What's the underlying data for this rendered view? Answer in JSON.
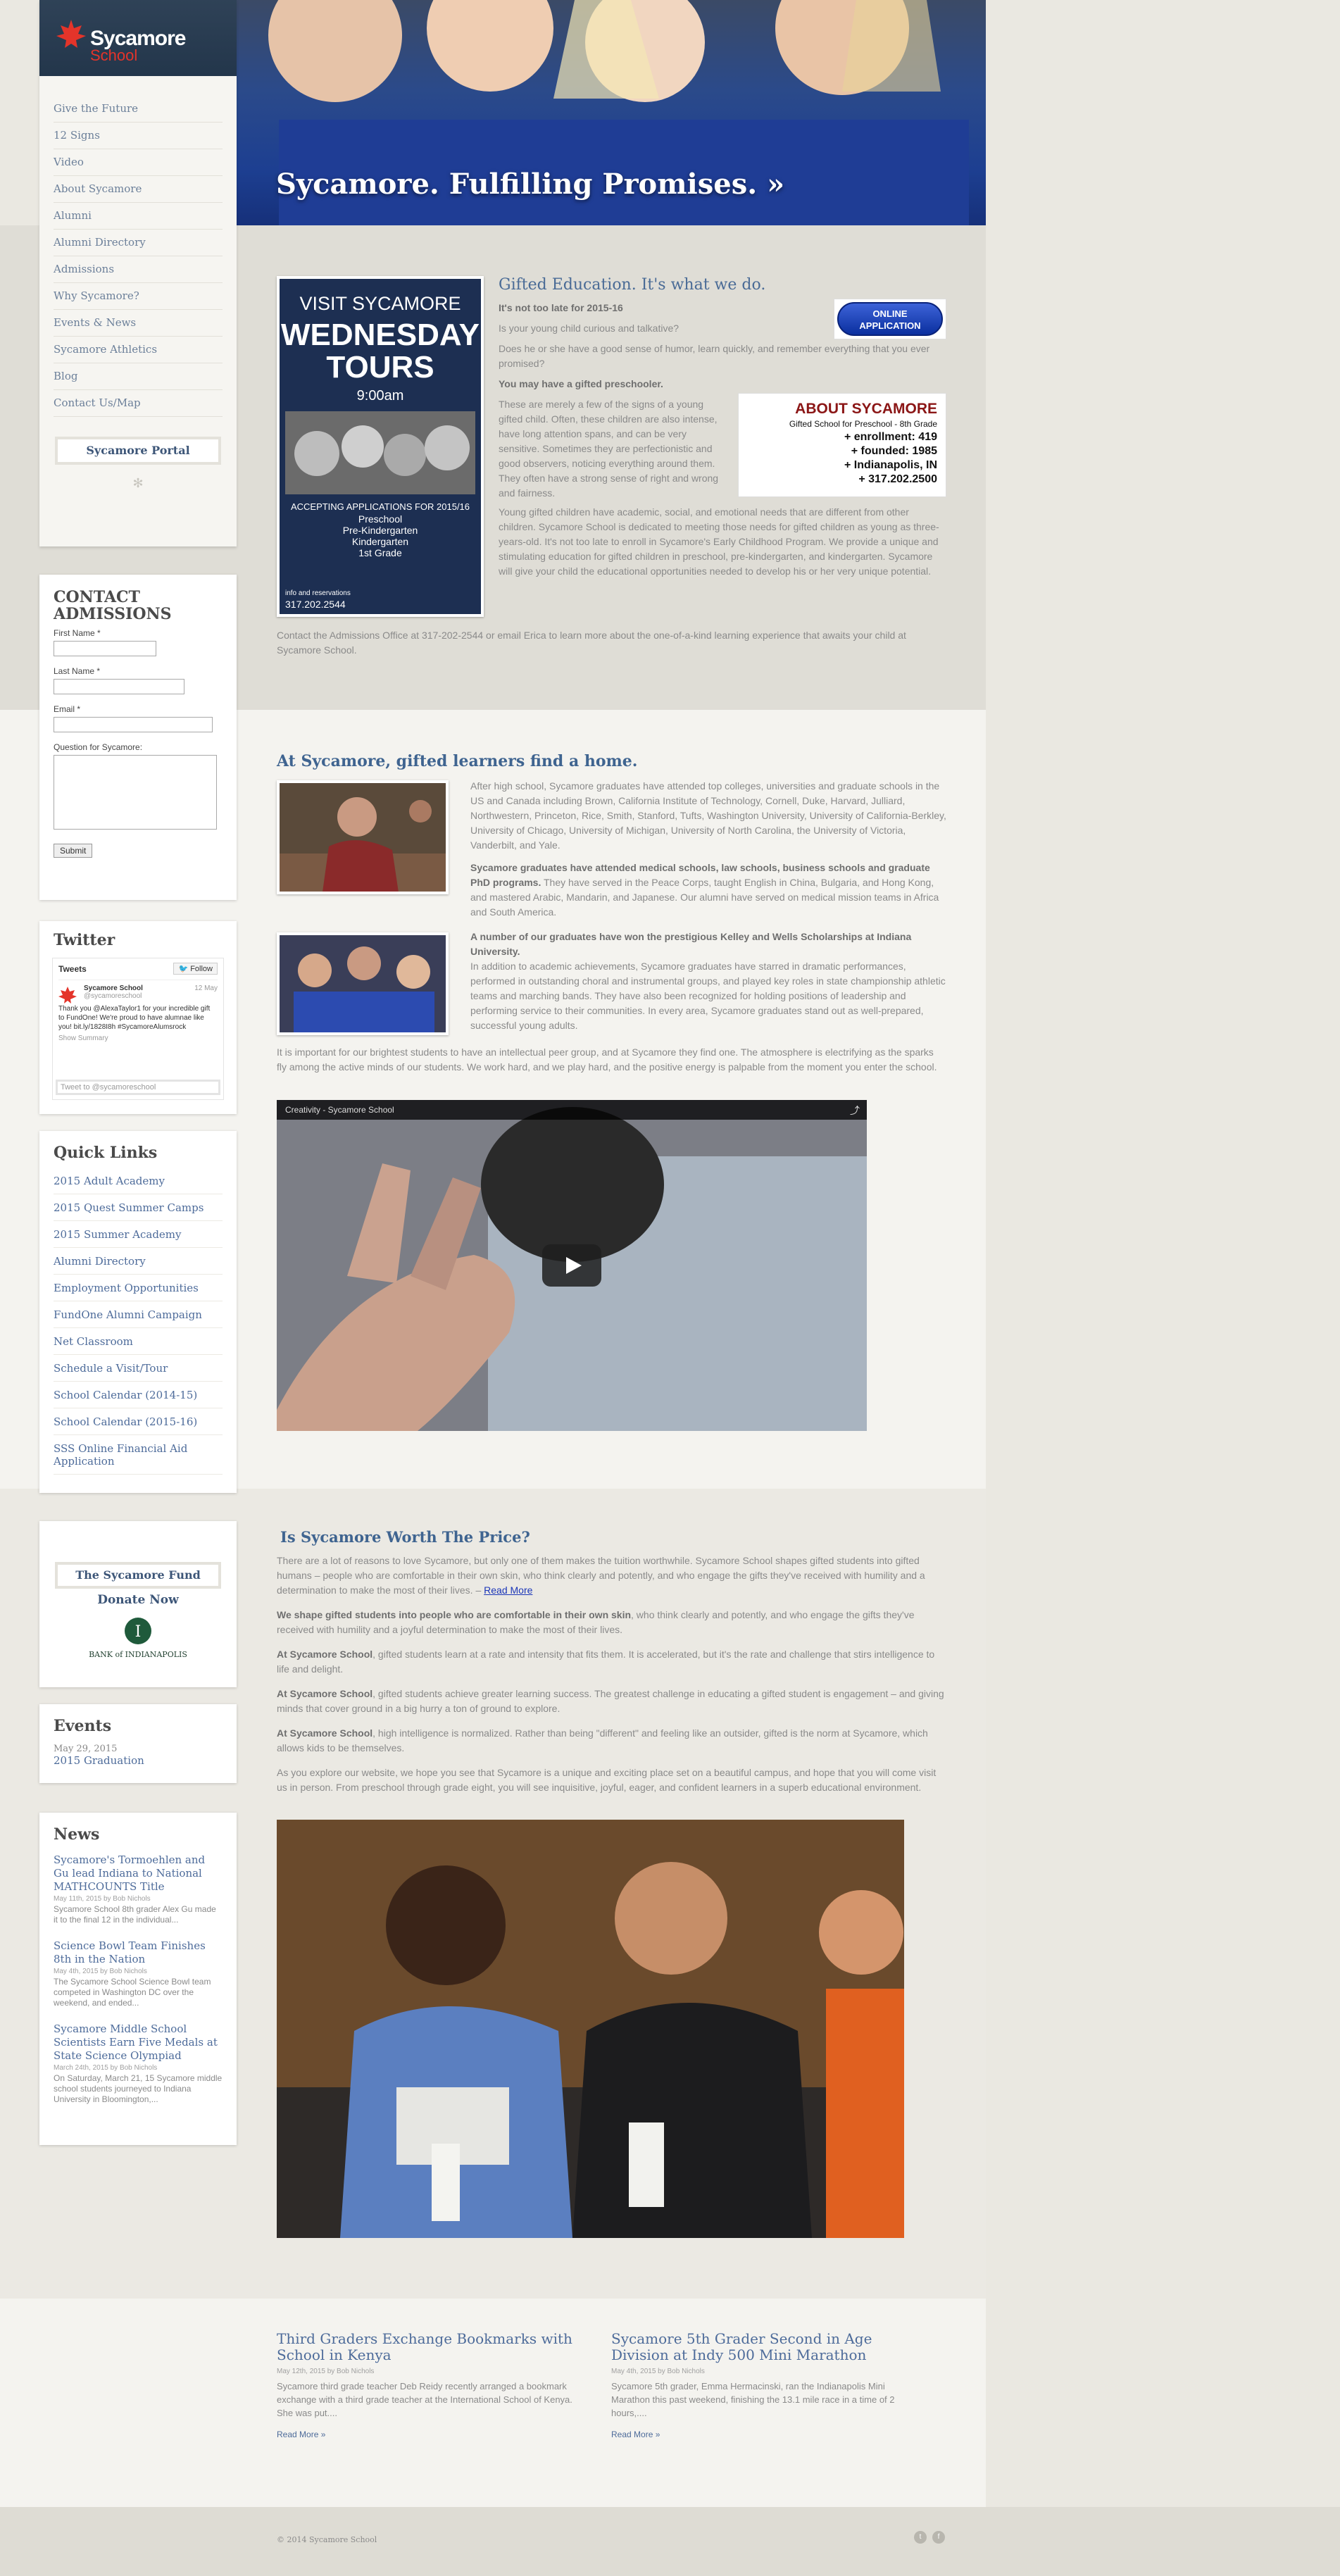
{
  "site": {
    "name": "Sycamore",
    "name_sub": "School"
  },
  "hero": {
    "title": "Sycamore. Fulfilling Promises. »"
  },
  "nav": {
    "items": [
      "Give the Future",
      "12 Signs",
      "Video",
      "About Sycamore",
      "Alumni",
      "Alumni Directory",
      "Admissions",
      "Why Sycamore?",
      "Events & News",
      "Sycamore Athletics",
      "Blog",
      "Contact Us/Map"
    ],
    "portal": "Sycamore Portal"
  },
  "contact": {
    "heading_1": "CONTACT",
    "heading_2": "ADMISSIONS",
    "first_name": "First Name *",
    "last_name": "Last Name *",
    "email": "Email *",
    "question": "Question for Sycamore:",
    "submit": "Submit"
  },
  "twitter": {
    "heading": "Twitter",
    "tweets_label": "Tweets",
    "follow": "Follow",
    "account_name": "Sycamore School",
    "handle": "@sycamoreschool",
    "date": "12 May",
    "text": "Thank you @AlexaTaylor1 for your incredible gift to FundOne! We're proud to have alumnae like you! bit.ly/1828I8h #SycamoreAlumsrock",
    "show_summary": "Show Summary",
    "tweet_to": "Tweet to @sycamoreschool"
  },
  "quick_links": {
    "heading": "Quick Links",
    "items": [
      "2015 Adult Academy",
      "2015 Quest Summer Camps",
      "2015 Summer Academy",
      "Alumni Directory",
      "Employment Opportunities",
      "FundOne Alumni Campaign",
      "Net Classroom",
      "Schedule a Visit/Tour",
      "School Calendar (2014-15)",
      "School Calendar (2015-16)",
      "SSS Online Financial Aid Application"
    ]
  },
  "fund": {
    "title": "The Sycamore Fund",
    "donate": "Donate Now",
    "sponsor": "BANK of INDIANAPOLIS"
  },
  "events": {
    "heading": "Events",
    "date": "May 29, 2015",
    "title": "2015 Graduation"
  },
  "news": {
    "heading": "News",
    "items": [
      {
        "title": "Sycamore's Tormoehlen and Gu lead Indiana to National MATHCOUNTS Title",
        "meta": "May 11th, 2015 by Bob Nichols",
        "snippet": "Sycamore School 8th grader Alex Gu made it to the final 12 in the individual..."
      },
      {
        "title": "Science Bowl Team Finishes 8th in the Nation",
        "meta": "May 4th, 2015 by Bob Nichols",
        "snippet": "The Sycamore School Science Bowl team competed in Washington DC over the weekend, and ended..."
      },
      {
        "title": "Sycamore Middle School Scientists Earn Five Medals at State Science Olympiad",
        "meta": "March 24th, 2015 by Bob Nichols",
        "snippet": "On Saturday, March 21, 15 Sycamore middle school students journeyed to Indiana University in Bloomington,..."
      }
    ]
  },
  "tours": {
    "line1": "VISIT SYCAMORE",
    "line2": "WEDNESDAY",
    "line3": "TOURS",
    "time": "9:00am",
    "accepting": "ACCEPTING APPLICATIONS FOR 2015/16",
    "grades": [
      "Preschool",
      "Pre-Kindergarten",
      "Kindergarten",
      "1st Grade"
    ],
    "info": "info and reservations",
    "phone": "317.202.2544"
  },
  "gifted": {
    "title": "Gifted Education. It's what we do.",
    "subhead": "It's not too late for 2015-16",
    "p1": "Is your young child curious and talkative?",
    "p2": "Does he or she have a good sense of humor, learn quickly, and remember everything that you ever promised?",
    "bold": "You may have a gifted preschooler.",
    "p3": "These are merely a few of the signs of a young gifted child. Often, these children are also intense, have long attention spans, and can be very sensitive. Sometimes they are perfectionistic and good observers, noticing everything around them. They often have a strong sense of right and wrong and fairness.",
    "p4": "Young gifted children have academic, social, and emotional needs that are different from other children. Sycamore School is dedicated to meeting those needs for gifted children as young as three-years-old. It's not too late to enroll in Sycamore's Early Childhood Program. We provide a unique and stimulating education for gifted children in preschool, pre-kindergarten, and kindergarten. Sycamore will give your child the educational opportunities needed to develop his or her very unique potential.",
    "p5": "Contact the Admissions Office at 317-202-2544 or email Erica to learn more about the one-of-a-kind learning experience that awaits your child at Sycamore School.",
    "apply_line1": "ONLINE",
    "apply_line2": "APPLICATION"
  },
  "about_box": {
    "title": "ABOUT SYCAMORE",
    "subtitle": "Gifted School for Preschool - 8th Grade",
    "lines": [
      "+ enrollment: 419",
      "+ founded: 1985",
      "+ Indianapolis, IN",
      "+ 317.202.2500"
    ]
  },
  "learners": {
    "title": "At Sycamore, gifted learners find a home.",
    "p1": "After high school, Sycamore graduates have attended top colleges, universities and graduate schools in the US and Canada including Brown, California Institute of Technology, Cornell, Duke, Harvard, Julliard, Northwestern, Princeton, Rice, Smith, Stanford, Tufts, Washington University, University of California-Berkley, University of Chicago, University of Michigan, University of North Carolina, the University of Victoria, Vanderbilt, and Yale.",
    "p2_bold": "Sycamore graduates have attended medical schools, law schools, business schools and graduate PhD programs.",
    "p2": " They have served in the Peace Corps, taught English in China, Bulgaria, and Hong Kong, and mastered Arabic, Mandarin, and Japanese. Our alumni have served on medical mission teams in Africa and South America.",
    "p3_bold": "A number of our graduates have won the prestigious Kelley and Wells Scholarships at Indiana University.",
    "p3": "In addition to academic achievements, Sycamore graduates have starred in dramatic performances, performed in outstanding choral and instrumental groups, and played key roles in state championship athletic teams and marching bands. They have also been recognized for holding positions of leadership and performing service to their communities. In every area, Sycamore graduates stand out as well-prepared, successful young adults.",
    "p4": "It is important for our brightest students to have an intellectual peer group, and at Sycamore they find one. The atmosphere is electrifying as the sparks fly among the active minds of our students. We work hard, and we play hard, and the positive energy is palpable from the moment you enter the school.",
    "video_title": "Creativity - Sycamore School"
  },
  "worth": {
    "title": "Is Sycamore Worth The Price?",
    "p1": "There are a lot of reasons to love Sycamore, but only one of them makes the tuition worthwhile. Sycamore School shapes gifted students into gifted humans – people who are comfortable in their own skin, who think clearly and potently, and who engage the gifts they've received with humility and a determination to make the most of their lives. –",
    "read_more": "Read More",
    "p2_bold": "We shape gifted students into people who are comfortable in their own skin",
    "p2": ", who think clearly and potently, and who engage the gifts they've received with humility and a joyful determination to make the most of their lives.",
    "p3_bold": "At Sycamore School",
    "p3": ", gifted students learn at a rate and intensity that fits them. It is accelerated, but it's the rate and challenge that stirs intelligence to life and delight.",
    "p4_bold": "At Sycamore School",
    "p4": ", gifted students achieve greater learning success. The greatest challenge in educating a gifted student is engagement – and giving minds that cover ground in a big hurry a ton of ground to explore.",
    "p5_bold": "At Sycamore School",
    "p5": ", high intelligence is normalized. Rather than being \"different\" and feeling like an outsider, gifted is the norm at Sycamore, which allows kids to be themselves.",
    "p6": "As you explore our website, we hope you see that Sycamore is a unique and exciting place set on a beautiful campus, and hope that you will come visit us in person. From preschool through grade eight, you will see inquisitive, joyful, eager, and confident learners in a superb educational environment."
  },
  "stories": [
    {
      "title": "Third Graders Exchange Bookmarks with School in Kenya",
      "meta": "May 12th, 2015 by Bob Nichols",
      "snippet": "Sycamore third grade teacher Deb Reidy recently arranged a bookmark exchange with a third grade teacher at the International School of Kenya. She was put....",
      "more": "Read More »"
    },
    {
      "title": "Sycamore 5th Grader Second in Age Division at Indy 500 Mini Marathon",
      "meta": "May 4th, 2015 by Bob Nichols",
      "snippet": "Sycamore 5th grader, Emma Hermacinski, ran the Indianapolis Mini Marathon this past weekend, finishing the 13.1 mile race in a time of 2 hours,....",
      "more": "Read More »"
    }
  ],
  "footer": {
    "copyright": "© 2014 Sycamore School"
  },
  "colors": {
    "brand_red": "#e4342a",
    "link_blue": "#4b6485",
    "navy": "#23364b"
  }
}
